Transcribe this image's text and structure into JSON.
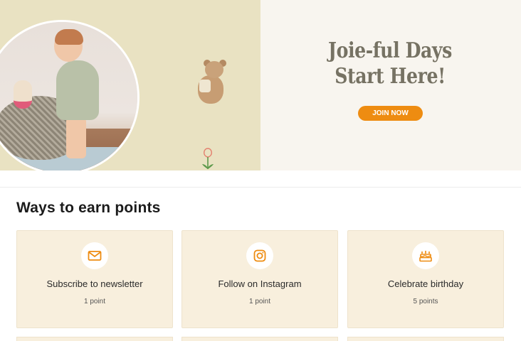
{
  "hero": {
    "headline_line1": "Joie-ful Days",
    "headline_line2": "Start Here!",
    "join_button": "JOIN NOW",
    "accent": "#ee8c11",
    "left_bg": "#e9e2c2",
    "right_bg": "#f8f5ef"
  },
  "section": {
    "title": "Ways to earn points"
  },
  "cards": [
    {
      "title": "Subscribe to newsletter",
      "points": "1 point",
      "icon": "mail-icon"
    },
    {
      "title": "Follow on Instagram",
      "points": "1 point",
      "icon": "instagram-icon"
    },
    {
      "title": "Celebrate birthday",
      "points": "5 points",
      "icon": "birthday-cake-icon"
    }
  ]
}
